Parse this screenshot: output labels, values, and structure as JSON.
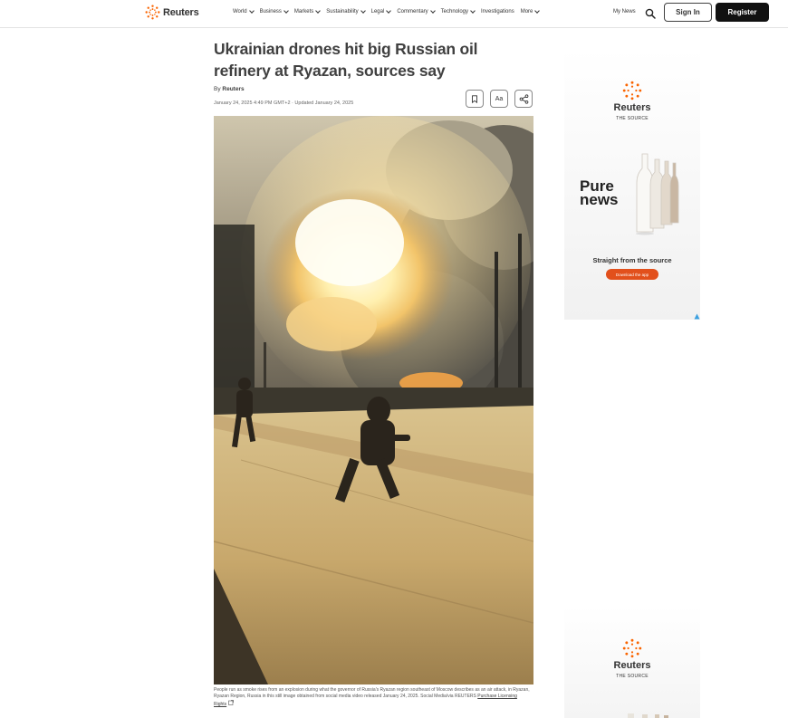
{
  "header": {
    "brand": "Reuters",
    "nav": [
      "World",
      "Business",
      "Markets",
      "Sustainability",
      "Legal",
      "Commentary",
      "Technology",
      "Investigations",
      "More"
    ],
    "nav_dropdown": [
      true,
      true,
      true,
      true,
      true,
      true,
      true,
      false,
      true
    ],
    "my_news": "My News",
    "search_icon": "search-icon",
    "sign_in": "Sign In",
    "register": "Register"
  },
  "article": {
    "headline": "Ukrainian drones hit big Russian oil refinery at Ryazan, sources say",
    "by": "By",
    "author": "Reuters",
    "dateline": "January 24, 2025 4:49 PM GMT+2 · Updated January 24, 2025",
    "tools": {
      "bookmark_icon": "bookmark-icon",
      "text_size_label": "Aa",
      "share_icon": "share-icon"
    },
    "caption": "People run as smoke rises from an explosion during what the governor of Russia's Ryazan region southeast of Moscow describes as an air attack, in Ryazan, Ryazan Region, Russia in this still image obtained from social media video released January 24, 2025. Social Media/via REUTERS",
    "licensing_link": "Purchase Licensing Rights"
  },
  "ads": {
    "top": {
      "brand": "Reuters",
      "brand_sub": "THE SOURCE",
      "headline_line1": "Pure",
      "headline_line2": "news",
      "tagline": "Straight from the source",
      "cta": "Download the app"
    },
    "bottom": {
      "brand": "Reuters",
      "brand_sub": "THE SOURCE"
    }
  },
  "colors": {
    "brand_orange": "#fa6400",
    "cta_orange": "#e2501c",
    "text_dark": "#404040",
    "register_bg": "#111111"
  }
}
